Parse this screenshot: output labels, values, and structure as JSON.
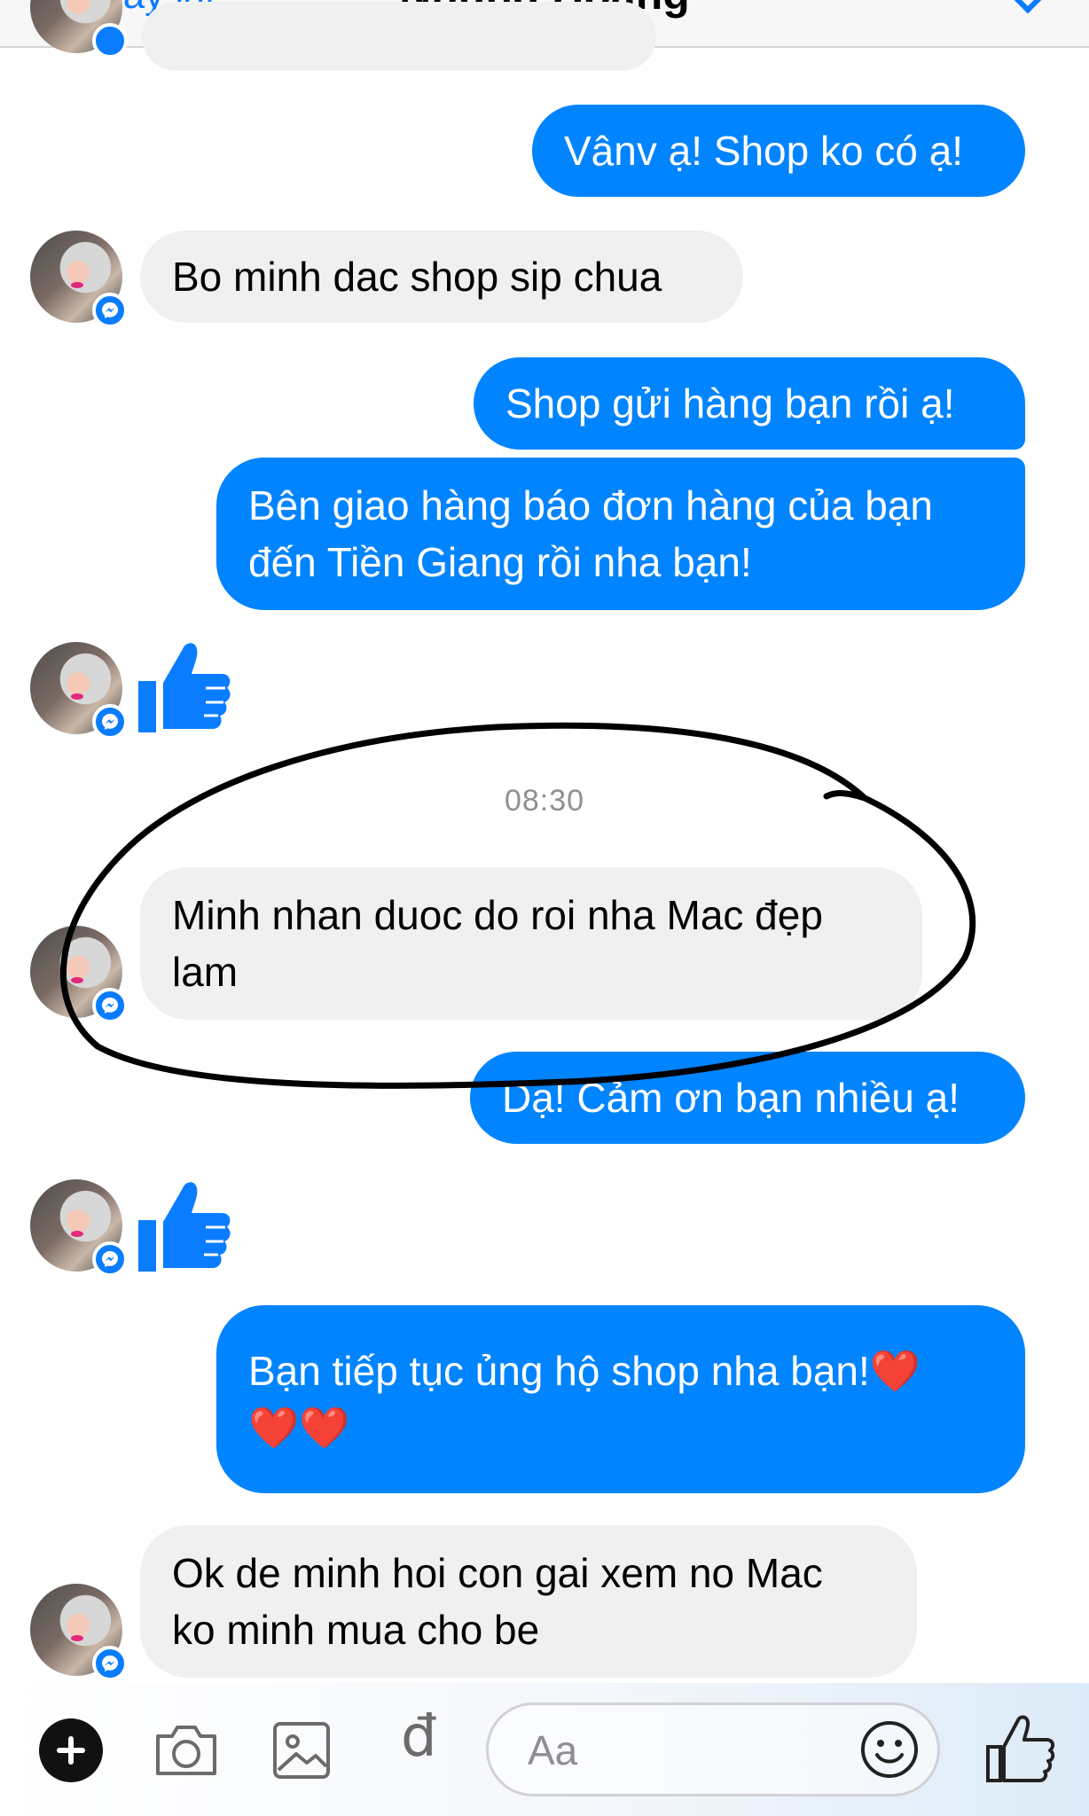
{
  "header": {
    "back_label": "Quay lại",
    "title": "Nhung Hoang"
  },
  "conversation": {
    "timestamp": "08:30",
    "messages": [
      {
        "from": "me",
        "lines": [
          "Vânv ạ! Shop ko có ạ!"
        ]
      },
      {
        "from": "them",
        "lines": [
          "Bo minh dac shop sip chua"
        ]
      },
      {
        "from": "me",
        "lines": [
          "Shop gửi hàng bạn rồi ạ!"
        ]
      },
      {
        "from": "me",
        "lines": [
          "Bên giao hàng báo đơn hàng của bạn",
          "đến Tiền Giang rồi nha bạn!"
        ]
      },
      {
        "from": "them",
        "sticker": "thumbs-up"
      },
      {
        "from": "them",
        "lines": [
          "Minh nhan duoc do roi nha Mac đẹp",
          "lam"
        ]
      },
      {
        "from": "me",
        "lines": [
          "Dạ! Cảm ơn bạn nhiều ạ!"
        ]
      },
      {
        "from": "them",
        "sticker": "thumbs-up"
      },
      {
        "from": "me",
        "lines": [
          "Bạn tiếp tục ủng hộ shop nha bạn!❤️",
          "❤️❤️"
        ]
      },
      {
        "from": "them",
        "lines": [
          "Ok de minh hoi con gai xem no Mac",
          "ko minh mua cho be"
        ]
      }
    ]
  },
  "composer": {
    "placeholder": "Aa",
    "currency_symbol": "đ",
    "icons": [
      "plus-icon",
      "camera-icon",
      "gallery-icon",
      "currency-dong-icon",
      "emoji-icon",
      "like-icon"
    ]
  },
  "colors": {
    "outgoing_bubble": "#0084ff",
    "incoming_bubble": "#f0f0f0",
    "accent": "#0a7cff",
    "annotation": "#000000"
  }
}
